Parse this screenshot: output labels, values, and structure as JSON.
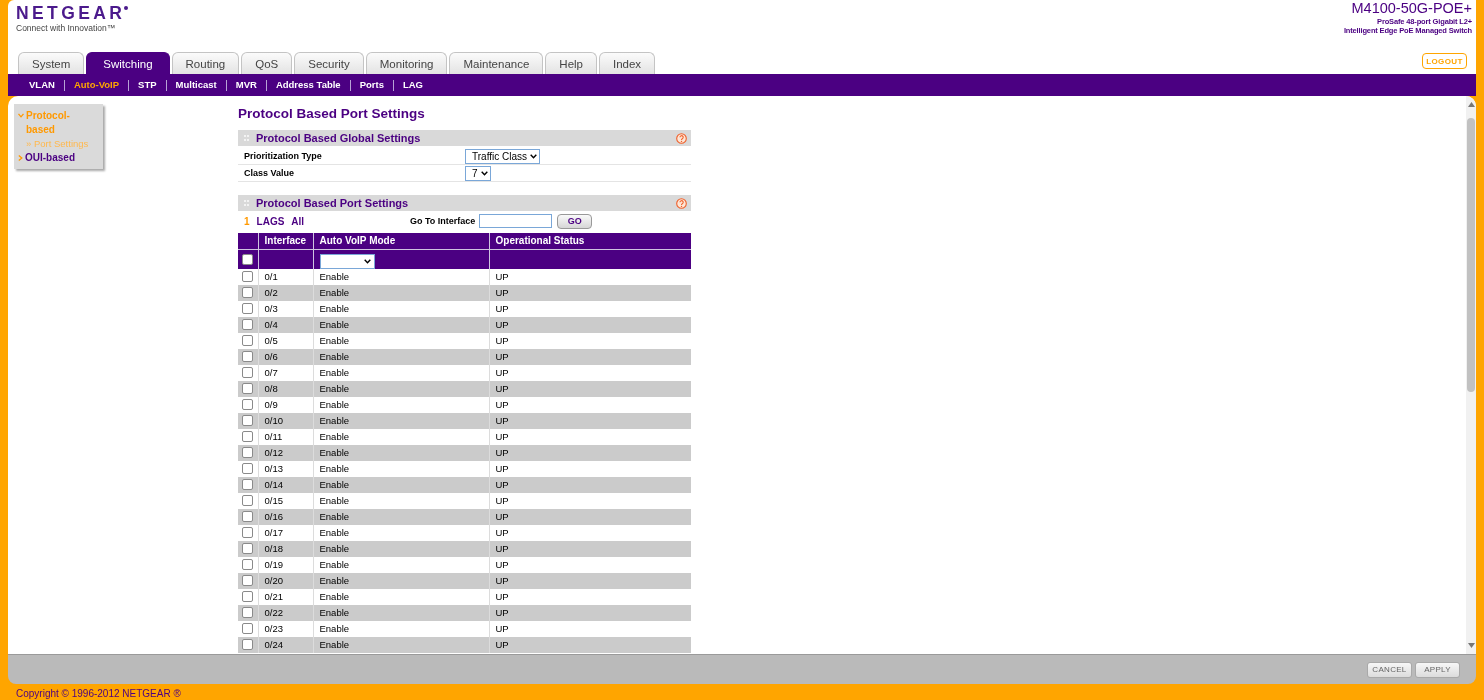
{
  "header": {
    "logo": "NETGEAR",
    "tagline": "Connect with Innovation™",
    "model": "M4100-50G-POE+",
    "description": [
      "ProSafe 48-port Gigabit L2+",
      "Intelligent Edge PoE Managed Switch"
    ],
    "logout": "LOGOUT"
  },
  "tabs": [
    {
      "label": "System",
      "selected": false
    },
    {
      "label": "Switching",
      "selected": true
    },
    {
      "label": "Routing",
      "selected": false
    },
    {
      "label": "QoS",
      "selected": false
    },
    {
      "label": "Security",
      "selected": false
    },
    {
      "label": "Monitoring",
      "selected": false
    },
    {
      "label": "Maintenance",
      "selected": false
    },
    {
      "label": "Help",
      "selected": false
    },
    {
      "label": "Index",
      "selected": false
    }
  ],
  "subnav": [
    {
      "label": "VLAN",
      "selected": false
    },
    {
      "label": "Auto-VoIP",
      "selected": true
    },
    {
      "label": "STP",
      "selected": false
    },
    {
      "label": "Multicast",
      "selected": false
    },
    {
      "label": "MVR",
      "selected": false
    },
    {
      "label": "Address Table",
      "selected": false
    },
    {
      "label": "Ports",
      "selected": false
    },
    {
      "label": "LAG",
      "selected": false
    }
  ],
  "sidebar": {
    "items": [
      {
        "label": "Protocol-based",
        "selected": true,
        "expanded": true,
        "children": [
          {
            "label": "» Port Settings",
            "selected": true
          }
        ]
      },
      {
        "label": "OUI-based",
        "selected": false,
        "expanded": false
      }
    ]
  },
  "page_title": "Protocol Based Port Settings",
  "global_settings": {
    "title": "Protocol Based Global Settings",
    "fields": [
      {
        "label": "Prioritization Type",
        "value": "Traffic Class"
      },
      {
        "label": "Class Value",
        "value": "7"
      }
    ]
  },
  "port_settings": {
    "title": "Protocol Based Port Settings",
    "filters": [
      {
        "label": "1",
        "selected": true
      },
      {
        "label": "LAGS",
        "selected": false
      },
      {
        "label": "All",
        "selected": false
      }
    ],
    "goto_label": "Go To Interface",
    "goto_button": "GO",
    "table": {
      "columns": [
        "Interface",
        "Auto VoIP Mode",
        "Operational Status"
      ],
      "bulk_row": {
        "checked": false
      },
      "rows": [
        {
          "interface": "0/1",
          "mode": "Enable",
          "status": "UP",
          "checked": false
        },
        {
          "interface": "0/2",
          "mode": "Enable",
          "status": "UP",
          "checked": false
        },
        {
          "interface": "0/3",
          "mode": "Enable",
          "status": "UP",
          "checked": false
        },
        {
          "interface": "0/4",
          "mode": "Enable",
          "status": "UP",
          "checked": false
        },
        {
          "interface": "0/5",
          "mode": "Enable",
          "status": "UP",
          "checked": false
        },
        {
          "interface": "0/6",
          "mode": "Enable",
          "status": "UP",
          "checked": false
        },
        {
          "interface": "0/7",
          "mode": "Enable",
          "status": "UP",
          "checked": false
        },
        {
          "interface": "0/8",
          "mode": "Enable",
          "status": "UP",
          "checked": false
        },
        {
          "interface": "0/9",
          "mode": "Enable",
          "status": "UP",
          "checked": false
        },
        {
          "interface": "0/10",
          "mode": "Enable",
          "status": "UP",
          "checked": false
        },
        {
          "interface": "0/11",
          "mode": "Enable",
          "status": "UP",
          "checked": false
        },
        {
          "interface": "0/12",
          "mode": "Enable",
          "status": "UP",
          "checked": false
        },
        {
          "interface": "0/13",
          "mode": "Enable",
          "status": "UP",
          "checked": false
        },
        {
          "interface": "0/14",
          "mode": "Enable",
          "status": "UP",
          "checked": false
        },
        {
          "interface": "0/15",
          "mode": "Enable",
          "status": "UP",
          "checked": false
        },
        {
          "interface": "0/16",
          "mode": "Enable",
          "status": "UP",
          "checked": false
        },
        {
          "interface": "0/17",
          "mode": "Enable",
          "status": "UP",
          "checked": false
        },
        {
          "interface": "0/18",
          "mode": "Enable",
          "status": "UP",
          "checked": false
        },
        {
          "interface": "0/19",
          "mode": "Enable",
          "status": "UP",
          "checked": false
        },
        {
          "interface": "0/20",
          "mode": "Enable",
          "status": "UP",
          "checked": false
        },
        {
          "interface": "0/21",
          "mode": "Enable",
          "status": "UP",
          "checked": false
        },
        {
          "interface": "0/22",
          "mode": "Enable",
          "status": "UP",
          "checked": false
        },
        {
          "interface": "0/23",
          "mode": "Enable",
          "status": "UP",
          "checked": false
        },
        {
          "interface": "0/24",
          "mode": "Enable",
          "status": "UP",
          "checked": false
        }
      ]
    }
  },
  "buttons": [
    "CANCEL",
    "APPLY"
  ],
  "copyright": "Copyright © 1996-2012 NETGEAR ®"
}
